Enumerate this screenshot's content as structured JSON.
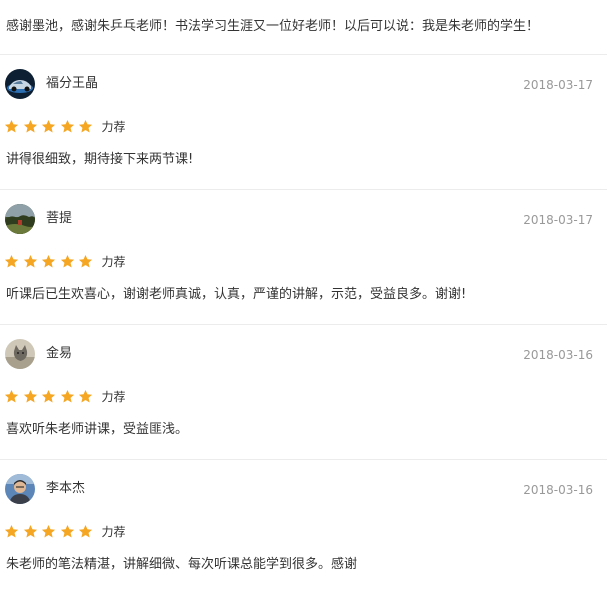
{
  "intro": {
    "text": "感谢墨池，感谢朱乒乓老师！书法学习生涯又一位好老师！以后可以说：我是朱老师的学生！"
  },
  "colors": {
    "star": "#f5a623",
    "divider": "#ececec",
    "date": "#999999",
    "text": "#333333"
  },
  "reviews": [
    {
      "name": "福分王晶",
      "date": "2018-03-17",
      "rating": 5,
      "rating_label": "力荐",
      "text": "讲得很细致，期待接下来两节课!",
      "avatar_icon": "car-avatar-icon"
    },
    {
      "name": "菩提",
      "date": "2018-03-17",
      "rating": 5,
      "rating_label": "力荐",
      "text": "听课后已生欢喜心，谢谢老师真诚，认真，严谨的讲解，示范，受益良多。谢谢!",
      "avatar_icon": "landscape-avatar-icon"
    },
    {
      "name": "金易",
      "date": "2018-03-16",
      "rating": 5,
      "rating_label": "力荐",
      "text": "喜欢听朱老师讲课，受益匪浅。",
      "avatar_icon": "cat-avatar-icon"
    },
    {
      "name": "李本杰",
      "date": "2018-03-16",
      "rating": 5,
      "rating_label": "力荐",
      "text": "朱老师的笔法精湛，讲解细微、每次听课总能学到很多。感谢",
      "avatar_icon": "person-avatar-icon"
    }
  ]
}
